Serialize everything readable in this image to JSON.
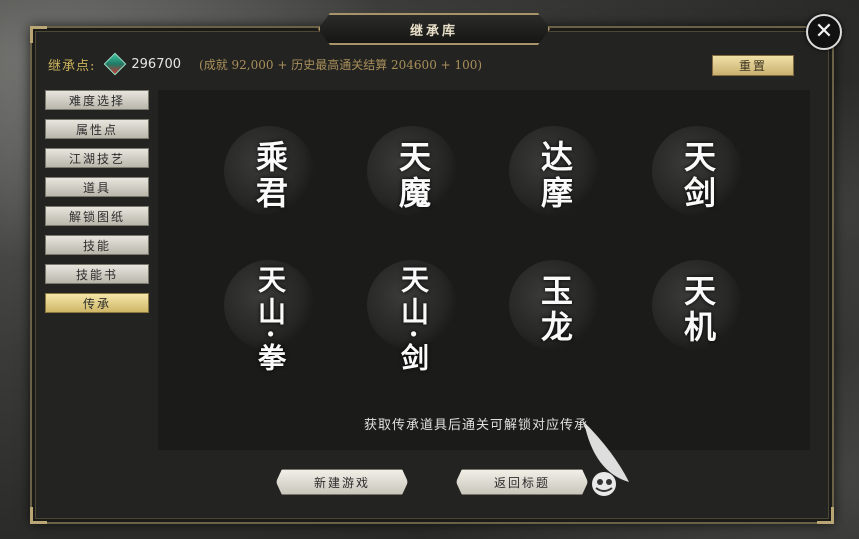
{
  "window": {
    "title": "继承库",
    "close_icon": "close-x-icon"
  },
  "points": {
    "label": "继承点:",
    "icon": "gem-icon",
    "value": "296700",
    "detail": "(成就 92,000 + 历史最高通关结算 204600 + 100)"
  },
  "reset_label": "重置",
  "side_menu": {
    "items": [
      {
        "label": "难度选择",
        "active": false
      },
      {
        "label": "属性点",
        "active": false
      },
      {
        "label": "江湖技艺",
        "active": false
      },
      {
        "label": "道具",
        "active": false
      },
      {
        "label": "解锁图纸",
        "active": false
      },
      {
        "label": "技能",
        "active": false
      },
      {
        "label": "技能书",
        "active": false
      },
      {
        "label": "传承",
        "active": true
      }
    ]
  },
  "inheritances": [
    {
      "name": "乘君"
    },
    {
      "name": "天魔"
    },
    {
      "name": "达摩"
    },
    {
      "name": "天剑"
    },
    {
      "name": "天山·拳"
    },
    {
      "name": "天山·剑"
    },
    {
      "name": "玉龙"
    },
    {
      "name": "天机"
    }
  ],
  "hint": "获取传承道具后通关可解锁对应传承",
  "buttons": {
    "new_game": "新建游戏",
    "return_title": "返回标题"
  },
  "colors": {
    "gold": "#cbb25b",
    "panel": "#232322",
    "active_tab": "#e8d48a"
  }
}
